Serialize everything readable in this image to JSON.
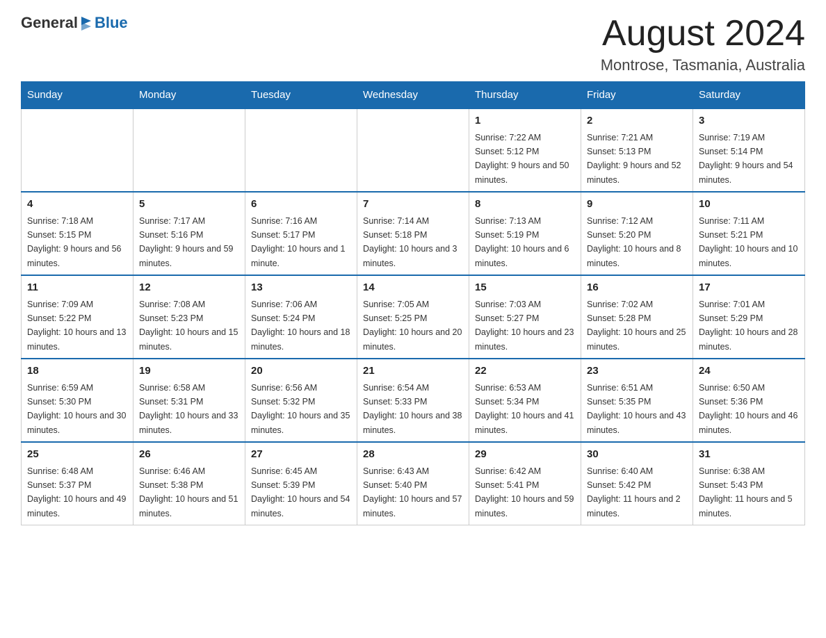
{
  "header": {
    "logo_general": "General",
    "logo_blue": "Blue",
    "month_title": "August 2024",
    "location": "Montrose, Tasmania, Australia"
  },
  "days_of_week": [
    "Sunday",
    "Monday",
    "Tuesday",
    "Wednesday",
    "Thursday",
    "Friday",
    "Saturday"
  ],
  "weeks": [
    [
      {
        "day": "",
        "info": ""
      },
      {
        "day": "",
        "info": ""
      },
      {
        "day": "",
        "info": ""
      },
      {
        "day": "",
        "info": ""
      },
      {
        "day": "1",
        "info": "Sunrise: 7:22 AM\nSunset: 5:12 PM\nDaylight: 9 hours and 50 minutes."
      },
      {
        "day": "2",
        "info": "Sunrise: 7:21 AM\nSunset: 5:13 PM\nDaylight: 9 hours and 52 minutes."
      },
      {
        "day": "3",
        "info": "Sunrise: 7:19 AM\nSunset: 5:14 PM\nDaylight: 9 hours and 54 minutes."
      }
    ],
    [
      {
        "day": "4",
        "info": "Sunrise: 7:18 AM\nSunset: 5:15 PM\nDaylight: 9 hours and 56 minutes."
      },
      {
        "day": "5",
        "info": "Sunrise: 7:17 AM\nSunset: 5:16 PM\nDaylight: 9 hours and 59 minutes."
      },
      {
        "day": "6",
        "info": "Sunrise: 7:16 AM\nSunset: 5:17 PM\nDaylight: 10 hours and 1 minute."
      },
      {
        "day": "7",
        "info": "Sunrise: 7:14 AM\nSunset: 5:18 PM\nDaylight: 10 hours and 3 minutes."
      },
      {
        "day": "8",
        "info": "Sunrise: 7:13 AM\nSunset: 5:19 PM\nDaylight: 10 hours and 6 minutes."
      },
      {
        "day": "9",
        "info": "Sunrise: 7:12 AM\nSunset: 5:20 PM\nDaylight: 10 hours and 8 minutes."
      },
      {
        "day": "10",
        "info": "Sunrise: 7:11 AM\nSunset: 5:21 PM\nDaylight: 10 hours and 10 minutes."
      }
    ],
    [
      {
        "day": "11",
        "info": "Sunrise: 7:09 AM\nSunset: 5:22 PM\nDaylight: 10 hours and 13 minutes."
      },
      {
        "day": "12",
        "info": "Sunrise: 7:08 AM\nSunset: 5:23 PM\nDaylight: 10 hours and 15 minutes."
      },
      {
        "day": "13",
        "info": "Sunrise: 7:06 AM\nSunset: 5:24 PM\nDaylight: 10 hours and 18 minutes."
      },
      {
        "day": "14",
        "info": "Sunrise: 7:05 AM\nSunset: 5:25 PM\nDaylight: 10 hours and 20 minutes."
      },
      {
        "day": "15",
        "info": "Sunrise: 7:03 AM\nSunset: 5:27 PM\nDaylight: 10 hours and 23 minutes."
      },
      {
        "day": "16",
        "info": "Sunrise: 7:02 AM\nSunset: 5:28 PM\nDaylight: 10 hours and 25 minutes."
      },
      {
        "day": "17",
        "info": "Sunrise: 7:01 AM\nSunset: 5:29 PM\nDaylight: 10 hours and 28 minutes."
      }
    ],
    [
      {
        "day": "18",
        "info": "Sunrise: 6:59 AM\nSunset: 5:30 PM\nDaylight: 10 hours and 30 minutes."
      },
      {
        "day": "19",
        "info": "Sunrise: 6:58 AM\nSunset: 5:31 PM\nDaylight: 10 hours and 33 minutes."
      },
      {
        "day": "20",
        "info": "Sunrise: 6:56 AM\nSunset: 5:32 PM\nDaylight: 10 hours and 35 minutes."
      },
      {
        "day": "21",
        "info": "Sunrise: 6:54 AM\nSunset: 5:33 PM\nDaylight: 10 hours and 38 minutes."
      },
      {
        "day": "22",
        "info": "Sunrise: 6:53 AM\nSunset: 5:34 PM\nDaylight: 10 hours and 41 minutes."
      },
      {
        "day": "23",
        "info": "Sunrise: 6:51 AM\nSunset: 5:35 PM\nDaylight: 10 hours and 43 minutes."
      },
      {
        "day": "24",
        "info": "Sunrise: 6:50 AM\nSunset: 5:36 PM\nDaylight: 10 hours and 46 minutes."
      }
    ],
    [
      {
        "day": "25",
        "info": "Sunrise: 6:48 AM\nSunset: 5:37 PM\nDaylight: 10 hours and 49 minutes."
      },
      {
        "day": "26",
        "info": "Sunrise: 6:46 AM\nSunset: 5:38 PM\nDaylight: 10 hours and 51 minutes."
      },
      {
        "day": "27",
        "info": "Sunrise: 6:45 AM\nSunset: 5:39 PM\nDaylight: 10 hours and 54 minutes."
      },
      {
        "day": "28",
        "info": "Sunrise: 6:43 AM\nSunset: 5:40 PM\nDaylight: 10 hours and 57 minutes."
      },
      {
        "day": "29",
        "info": "Sunrise: 6:42 AM\nSunset: 5:41 PM\nDaylight: 10 hours and 59 minutes."
      },
      {
        "day": "30",
        "info": "Sunrise: 6:40 AM\nSunset: 5:42 PM\nDaylight: 11 hours and 2 minutes."
      },
      {
        "day": "31",
        "info": "Sunrise: 6:38 AM\nSunset: 5:43 PM\nDaylight: 11 hours and 5 minutes."
      }
    ]
  ]
}
